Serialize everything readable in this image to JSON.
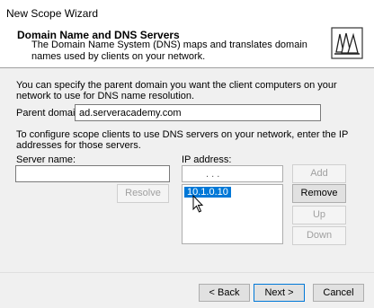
{
  "window": {
    "title": "New Scope Wizard"
  },
  "header": {
    "title": "Domain Name and DNS Servers",
    "description": "The Domain Name System (DNS) maps and translates domain names used by clients on your network."
  },
  "content": {
    "intro": "You can specify the parent domain you want the client computers on your network to use for DNS name resolution.",
    "parent_domain_label": "Parent domain:",
    "parent_domain_value": "ad.serveracademy.com",
    "dns_intro": "To configure scope clients to use DNS servers on your network, enter the IP addresses for those servers.",
    "server_name_label": "Server name:",
    "server_name_value": "",
    "ip_address_label": "IP address:",
    "ip_dots": ".          .          .",
    "ip_list": [
      "10.1.0.10"
    ]
  },
  "buttons": {
    "resolve": "Resolve",
    "add": "Add",
    "remove": "Remove",
    "up": "Up",
    "down": "Down",
    "back": "< Back",
    "next": "Next >",
    "cancel": "Cancel"
  },
  "colors": {
    "selection": "#0078d7",
    "accent_border": "#0078d7"
  },
  "icons": {
    "header_icon": "books-wizard-icon",
    "cursor": "arrow-pointer-icon"
  }
}
